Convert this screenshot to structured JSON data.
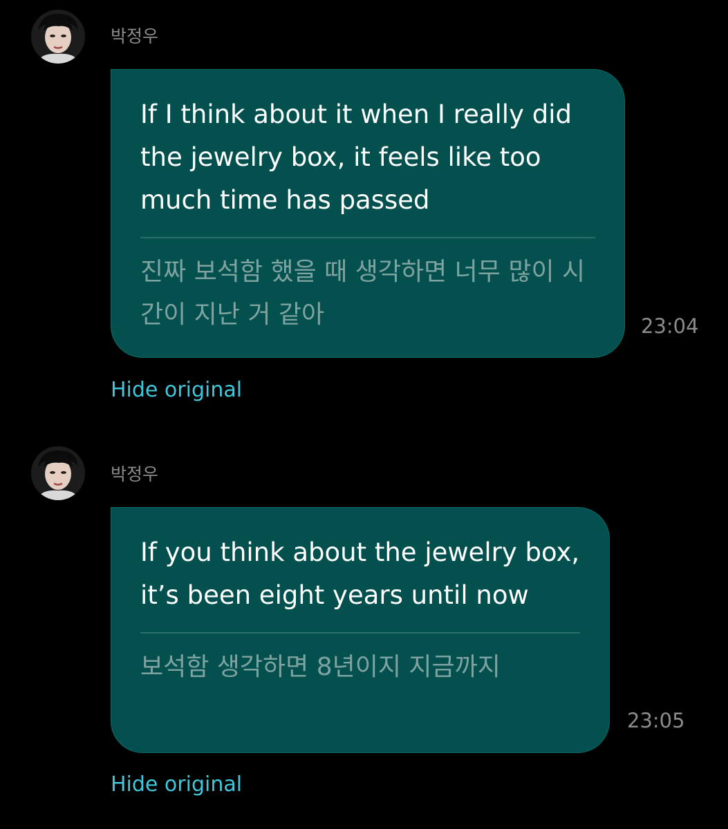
{
  "messages": [
    {
      "sender": "박정우",
      "avatar_icon": "profile-photo",
      "translated_text": "If I think about it when I really did the jewelry box, it feels like too much time has passed",
      "original_text": "진짜 보석함 했을 때 생각하면 너무 많이 시간이 지난 거 같아",
      "time": "23:04",
      "toggle_label": "Hide original"
    },
    {
      "sender": "박정우",
      "avatar_icon": "profile-photo",
      "translated_text": "If you think about the jewelry box, it’s been eight years until now",
      "original_text": "보석함 생각하면 8년이지 지금까지",
      "time": "23:05",
      "toggle_label": "Hide original"
    }
  ],
  "colors": {
    "background": "#000000",
    "bubble": "#03504f",
    "link": "#3fc8dc",
    "meta_text": "#8c8c8c"
  }
}
